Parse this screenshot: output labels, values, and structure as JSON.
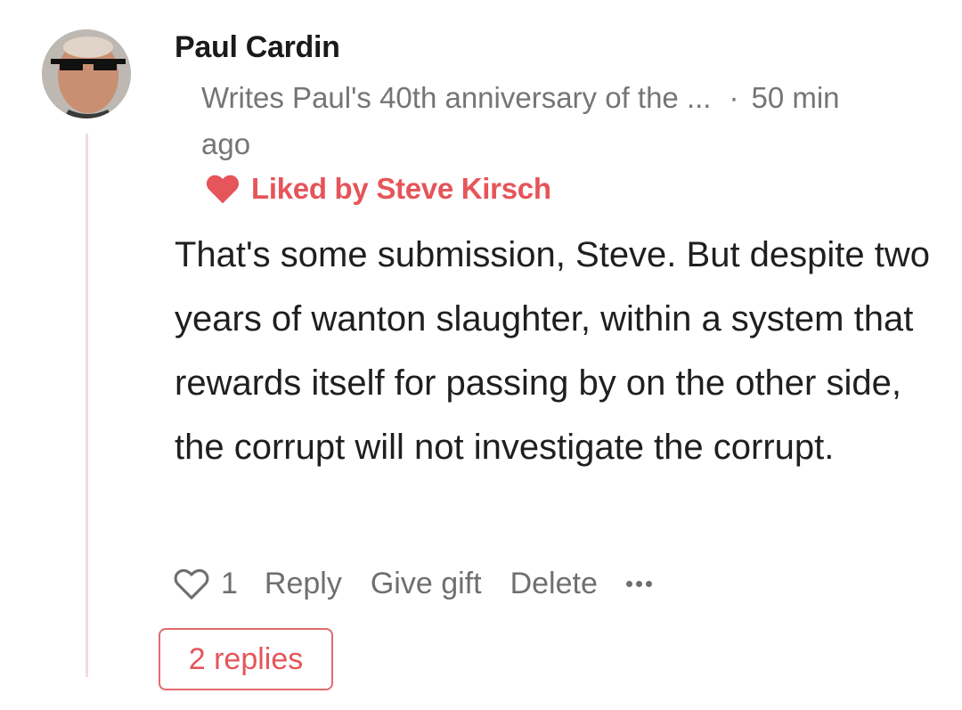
{
  "comment": {
    "author": "Paul Cardin",
    "publication": "Writes Paul's 40th anniversary of the ...",
    "separator": "·",
    "time_part1": "50 min",
    "time_part2": "ago",
    "liked_by": "Liked by Steve Kirsch",
    "body": "That's some submission, Steve. But despite two years of wanton slaughter, within a system that rewards itself for passing by on the other side, the corrupt will not investigate the corrupt.",
    "like_count": "1"
  },
  "actions": {
    "reply": "Reply",
    "give_gift": "Give gift",
    "delete": "Delete"
  },
  "replies_label": "2 replies",
  "icons": {
    "liked": "heart-filled-icon",
    "like": "heart-outline-icon",
    "more": "more-horizontal-icon",
    "avatar": "user-avatar-photo"
  },
  "colors": {
    "accent": "#e5555a",
    "meta": "#757575",
    "thread_line": "#f1dcdc"
  }
}
